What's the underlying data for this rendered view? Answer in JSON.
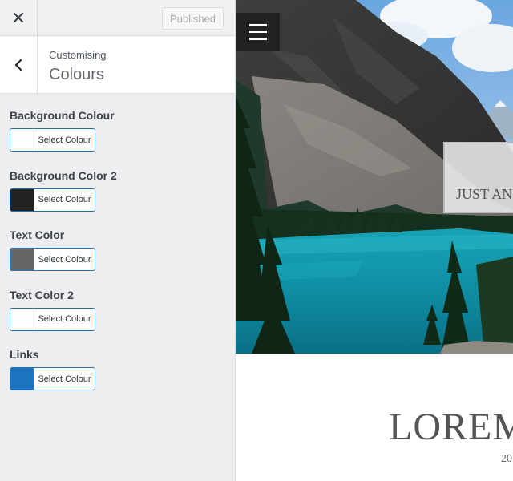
{
  "topbar": {
    "close_icon": "close-icon",
    "published_label": "Published"
  },
  "section": {
    "back_icon": "chevron-left-icon",
    "breadcrumb": "Customising",
    "title": "Colours"
  },
  "controls": [
    {
      "label": "Background Colour",
      "button_label": "Select Colour",
      "color": "#ffffff"
    },
    {
      "label": "Background Color 2",
      "button_label": "Select Colour",
      "color": "#222222"
    },
    {
      "label": "Text Color",
      "button_label": "Select Colour",
      "color": "#666666"
    },
    {
      "label": "Text Color 2",
      "button_label": "Select Colour",
      "color": "#ffffff"
    },
    {
      "label": "Links",
      "button_label": "Select Colour",
      "color": "#1e73be"
    }
  ],
  "preview": {
    "menu_icon": "hamburger-menu-icon",
    "hero_text": "JUST AN",
    "post_title": "LOREM",
    "post_date": "20"
  },
  "colors": {
    "accent": "#2271b1",
    "sidebar_bg": "#eeeef1",
    "lake": "#1fa8b8"
  }
}
